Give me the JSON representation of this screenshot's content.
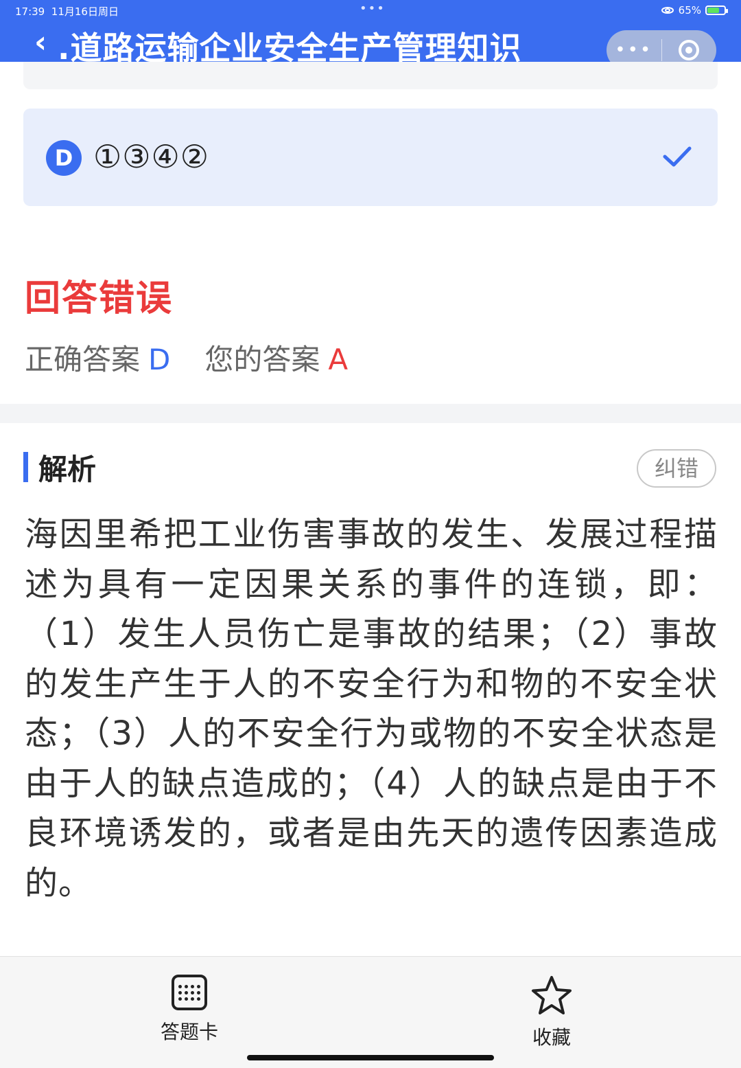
{
  "status_bar": {
    "time": "17:39",
    "date": "11月16日周日",
    "dots": "•••",
    "battery": "65%"
  },
  "header": {
    "back_icon": "‹",
    "title": ".道路运输企业安全生产管理知识",
    "more_label": "•••",
    "accent_color": "#3a6df0"
  },
  "option": {
    "letter": "D",
    "text": "①③④②",
    "selected_mark": "check-icon"
  },
  "result": {
    "title": "回答错误",
    "correct_label": "正确答案",
    "correct_value": "D",
    "mine_label": "您的答案",
    "mine_value": "A"
  },
  "analysis": {
    "title": "解析",
    "correct_button": "纠错",
    "text": "海因里希把工业伤害事故的发生、发展过程描述为具有一定因果关系的事件的连锁，即：（1）发生人员伤亡是事故的结果；（2）事故的发生产生于人的不安全行为和物的不安全状态；（3）人的不安全行为或物的不安全状态是由于人的缺点造成的；（4）人的缺点是由于不良环境诱发的，或者是由先天的遗传因素造成的。"
  },
  "bottom_nav": {
    "card_label": "答题卡",
    "fav_label": "收藏"
  }
}
